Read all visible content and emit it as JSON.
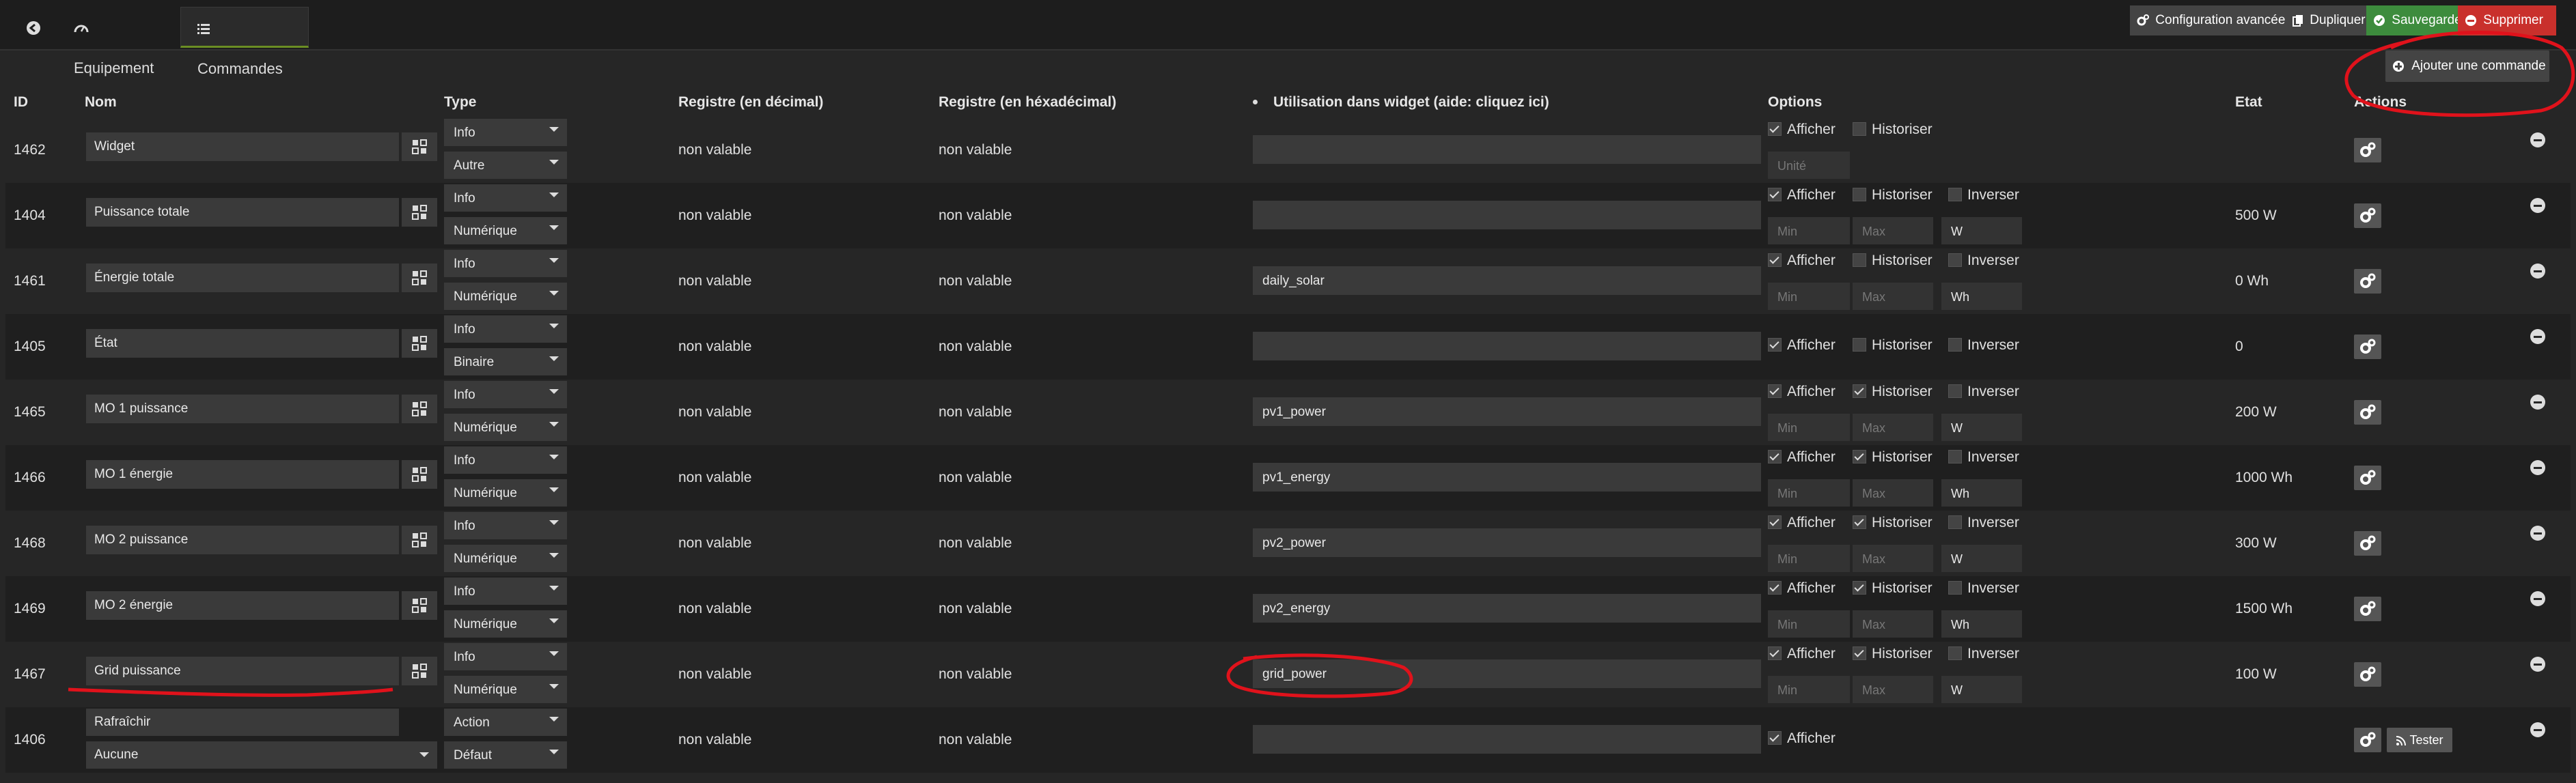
{
  "tabs": {
    "equipement": "Equipement",
    "commandes": "Commandes"
  },
  "toolbar": {
    "config": "Configuration avancée",
    "dupliquer": "Dupliquer",
    "sauvegarder": "Sauvegarder",
    "supprimer": "Supprimer",
    "ajouter": "Ajouter une commande"
  },
  "headers": {
    "id": "ID",
    "nom": "Nom",
    "type": "Type",
    "reg_dec": "Registre (en décimal)",
    "reg_hex": "Registre (en héxadécimal)",
    "widget": "Utilisation dans widget (aide: cliquez ici)",
    "options": "Options",
    "etat": "Etat",
    "actions": "Actions"
  },
  "labels": {
    "afficher": "Afficher",
    "historiser": "Historiser",
    "inverser": "Inverser",
    "unite": "Unité",
    "min": "Min",
    "max": "Max",
    "tester": "Tester"
  },
  "rows": [
    {
      "id": "1462",
      "nom": "Widget",
      "type1": "Info",
      "type2": "Autre",
      "reg_dec": "non valable",
      "reg_hex": "non valable",
      "widget": "",
      "hist": false,
      "unit": "",
      "etat": ""
    },
    {
      "id": "1404",
      "nom": "Puissance totale",
      "type1": "Info",
      "type2": "Numérique",
      "reg_dec": "non valable",
      "reg_hex": "non valable",
      "widget": "",
      "hist": false,
      "unit": "W",
      "etat": "500 W"
    },
    {
      "id": "1461",
      "nom": "Énergie totale",
      "type1": "Info",
      "type2": "Numérique",
      "reg_dec": "non valable",
      "reg_hex": "non valable",
      "widget": "daily_solar",
      "hist": false,
      "unit": "Wh",
      "etat": "0 Wh"
    },
    {
      "id": "1405",
      "nom": "État",
      "type1": "Info",
      "type2": "Binaire",
      "reg_dec": "non valable",
      "reg_hex": "non valable",
      "widget": "",
      "hist": false,
      "unit": "",
      "etat": "0"
    },
    {
      "id": "1465",
      "nom": "MO 1 puissance",
      "type1": "Info",
      "type2": "Numérique",
      "reg_dec": "non valable",
      "reg_hex": "non valable",
      "widget": "pv1_power",
      "hist": true,
      "unit": "W",
      "etat": "200 W"
    },
    {
      "id": "1466",
      "nom": "MO 1 énergie",
      "type1": "Info",
      "type2": "Numérique",
      "reg_dec": "non valable",
      "reg_hex": "non valable",
      "widget": "pv1_energy",
      "hist": true,
      "unit": "Wh",
      "etat": "1000 Wh"
    },
    {
      "id": "1468",
      "nom": "MO 2 puissance",
      "type1": "Info",
      "type2": "Numérique",
      "reg_dec": "non valable",
      "reg_hex": "non valable",
      "widget": "pv2_power",
      "hist": true,
      "unit": "W",
      "etat": "300 W"
    },
    {
      "id": "1469",
      "nom": "MO 2 énergie",
      "type1": "Info",
      "type2": "Numérique",
      "reg_dec": "non valable",
      "reg_hex": "non valable",
      "widget": "pv2_energy",
      "hist": true,
      "unit": "Wh",
      "etat": "1500 Wh"
    },
    {
      "id": "1467",
      "nom": "Grid puissance",
      "type1": "Info",
      "type2": "Numérique",
      "reg_dec": "non valable",
      "reg_hex": "non valable",
      "widget": "grid_power",
      "hist": true,
      "unit": "W",
      "etat": "100 W"
    },
    {
      "id": "1406",
      "nom": "Rafraîchir",
      "nom2": "Aucune",
      "type1": "Action",
      "type2": "Défaut",
      "reg_dec": "non valable",
      "reg_hex": "non valable",
      "widget": "",
      "etat": ""
    }
  ],
  "colors": {
    "save": "#3d8c3d",
    "delete": "#c9302c",
    "annotation": "#e0121b"
  }
}
